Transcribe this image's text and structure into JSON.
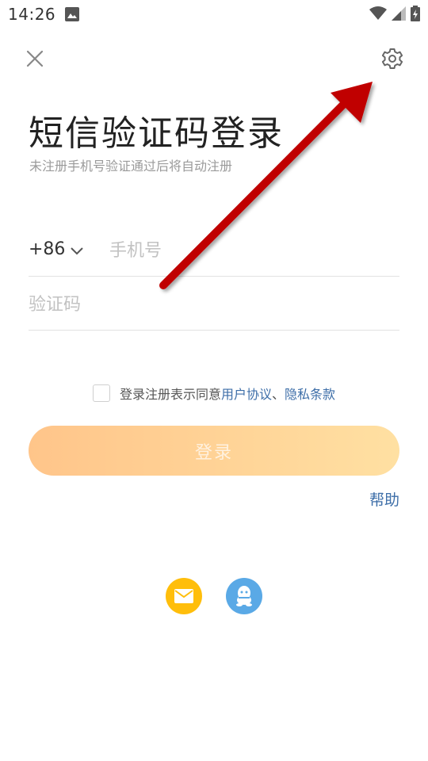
{
  "status_bar": {
    "time": "14:26"
  },
  "header": {
    "close_icon": "close-icon",
    "settings_icon": "gear-icon"
  },
  "title": "短信验证码登录",
  "subtitle": "未注册手机号验证通过后将自动注册",
  "form": {
    "country_code": "+86",
    "phone_placeholder": "手机号",
    "phone_value": "",
    "code_placeholder": "验证码",
    "code_value": ""
  },
  "agreement": {
    "checked": false,
    "prefix": "登录注册表示同意",
    "user_agreement": "用户协议",
    "separator": "、",
    "privacy_policy": "隐私条款"
  },
  "login_button": "登录",
  "help_link": "帮助",
  "social": {
    "mail_icon": "mail-icon",
    "qq_icon": "qq-icon"
  },
  "colors": {
    "link": "#3d6ea8",
    "login_gradient_start": "#ffc58a",
    "login_gradient_end": "#ffe0a2",
    "mail_bg": "#ffbe0b",
    "qq_bg": "#5aa9e6",
    "annotation_arrow": "#c00000"
  }
}
